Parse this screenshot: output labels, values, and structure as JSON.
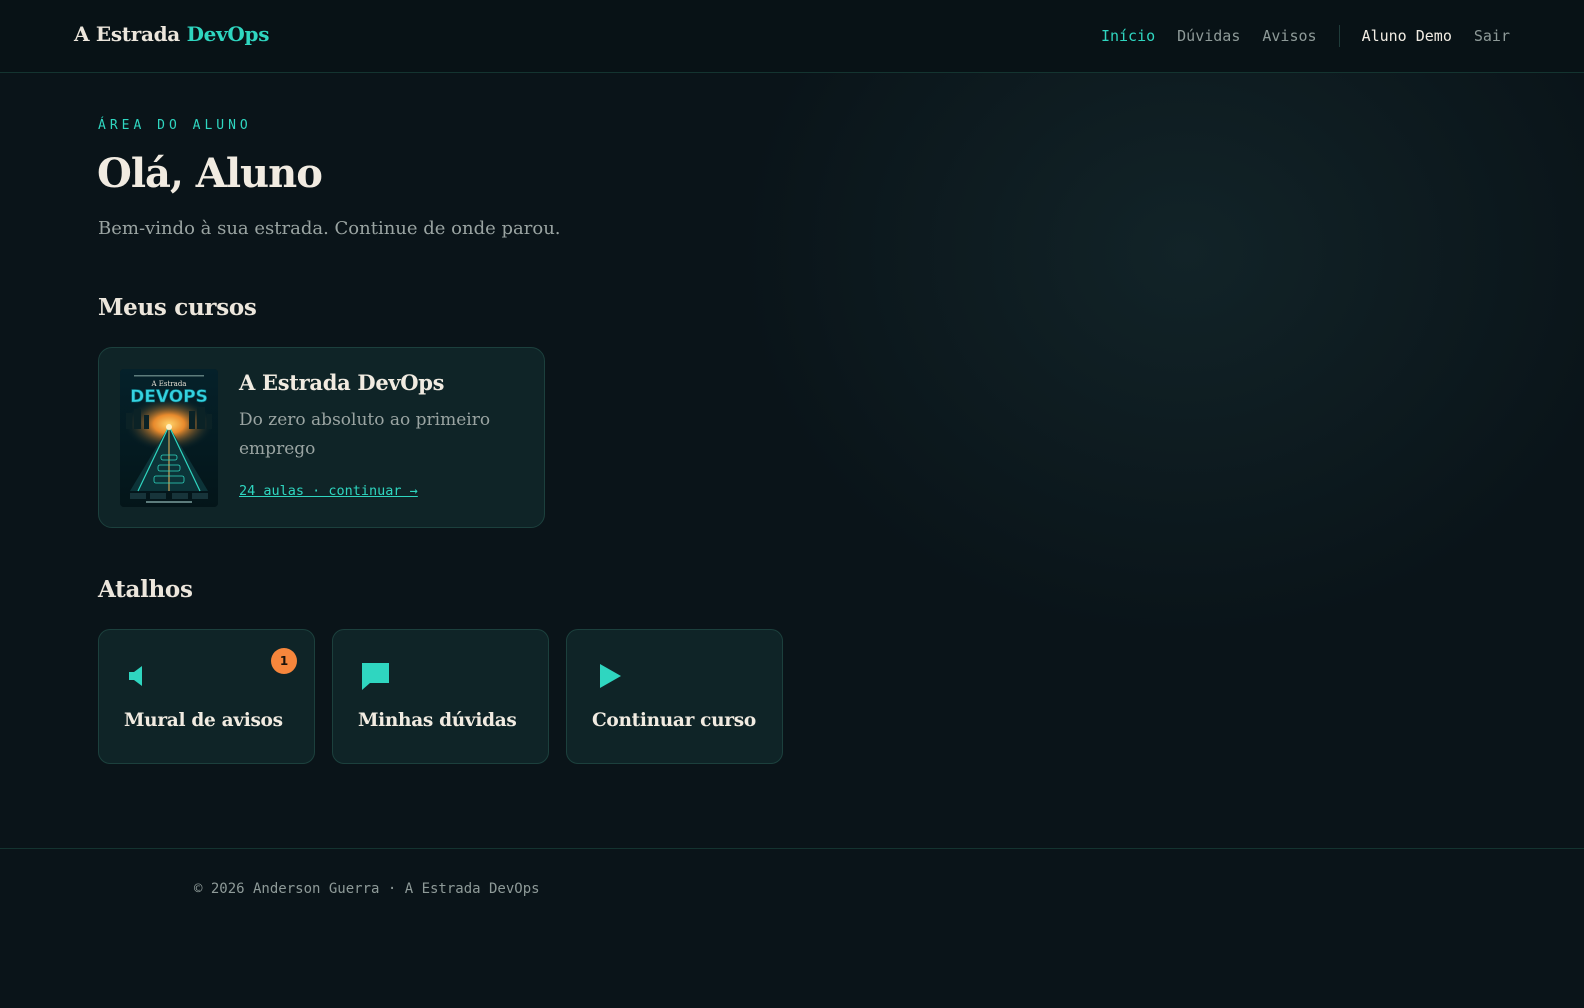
{
  "colors": {
    "background": "#0a1419",
    "header": "#081216",
    "card": "#0f2427",
    "accent": "#2fd6c0",
    "badge": "#f6863c",
    "text": "#ece6dc",
    "muted": "#9aa4a2"
  },
  "header": {
    "brand_part1": "A Estrada",
    "brand_part2": "DevOps",
    "nav": [
      {
        "label": "Início",
        "active": true
      },
      {
        "label": "Dúvidas",
        "active": false
      },
      {
        "label": "Avisos",
        "active": false
      }
    ],
    "user_name": "Aluno Demo",
    "logout_label": "Sair"
  },
  "hero": {
    "eyebrow": "ÁREA DO ALUNO",
    "title": "Olá, Aluno",
    "subtitle": "Bem-vindo à sua estrada. Continue de onde parou."
  },
  "courses": {
    "section_title": "Meus cursos",
    "items": [
      {
        "cover_icon": "book-cover-image",
        "cover_title_small": "A Estrada",
        "cover_title_big": "DEVOPS",
        "title": "A Estrada DevOps",
        "description": "Do zero absoluto ao primeiro emprego",
        "meta": "24 aulas · continuar →"
      }
    ]
  },
  "shortcuts": {
    "section_title": "Atalhos",
    "items": [
      {
        "icon": "megaphone-icon",
        "label": "Mural de avisos",
        "badge": "1"
      },
      {
        "icon": "chat-bubble-icon",
        "label": "Minhas dúvidas"
      },
      {
        "icon": "play-icon",
        "label": "Continuar curso"
      }
    ]
  },
  "footer": {
    "copyright": "© 2026 Anderson Guerra · A Estrada DevOps"
  }
}
